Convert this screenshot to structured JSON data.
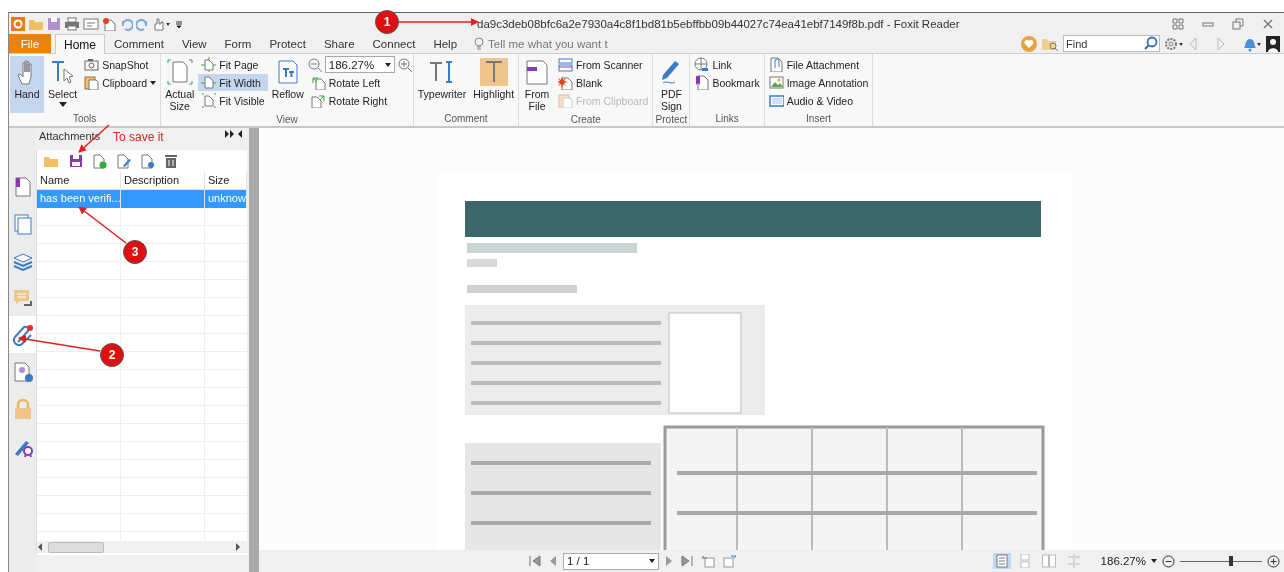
{
  "title_bar": {
    "title": "da9c3deb08bfc6a2e7930a4c8f1bd81b5ebffbb09b44027c74ea41ebf7149f8b.pdf - Foxit Reader"
  },
  "tabs": [
    {
      "label": "File",
      "kind": "file",
      "selected": false
    },
    {
      "label": "Home",
      "kind": "tab",
      "selected": true
    },
    {
      "label": "Comment",
      "kind": "tab",
      "selected": false
    },
    {
      "label": "View",
      "kind": "tab",
      "selected": false
    },
    {
      "label": "Form",
      "kind": "tab",
      "selected": false
    },
    {
      "label": "Protect",
      "kind": "tab",
      "selected": false
    },
    {
      "label": "Share",
      "kind": "tab",
      "selected": false
    },
    {
      "label": "Connect",
      "kind": "tab",
      "selected": false
    },
    {
      "label": "Help",
      "kind": "tab",
      "selected": false
    }
  ],
  "tell_me": {
    "placeholder": "Tell me what you want t"
  },
  "find": {
    "placeholder": "Find"
  },
  "ribbon": [
    {
      "label": "Tools",
      "columns": [
        {
          "kind": "large",
          "label": "Hand",
          "selected": true,
          "disabled": false
        },
        {
          "kind": "large-menu",
          "label": "Select",
          "selected": false,
          "disabled": false
        },
        {
          "kind": "stack",
          "items": [
            {
              "kind": "button",
              "label": "SnapShot",
              "selected": false,
              "disabled": false
            },
            {
              "kind": "menu",
              "label": "Clipboard",
              "selected": false,
              "disabled": false
            }
          ]
        }
      ]
    },
    {
      "label": "View",
      "columns": [
        {
          "kind": "large",
          "label": "Actual Size",
          "selected": false,
          "disabled": false
        },
        {
          "kind": "stack",
          "items": [
            {
              "kind": "button",
              "label": "Fit Page",
              "selected": false,
              "disabled": false
            },
            {
              "kind": "button",
              "label": "Fit Width",
              "selected": true,
              "disabled": false
            },
            {
              "kind": "button",
              "label": "Fit Visible",
              "selected": false,
              "disabled": false
            }
          ]
        },
        {
          "kind": "large",
          "label": "Reflow",
          "selected": false,
          "disabled": false
        },
        {
          "kind": "stack",
          "items": [
            {
              "kind": "zoom",
              "value": "186.27%"
            },
            {
              "kind": "button",
              "label": "Rotate Left",
              "selected": false,
              "disabled": false
            },
            {
              "kind": "button",
              "label": "Rotate Right",
              "selected": false,
              "disabled": false
            }
          ]
        }
      ]
    },
    {
      "label": "Comment",
      "columns": [
        {
          "kind": "large",
          "label": "Typewriter",
          "selected": false,
          "disabled": false
        },
        {
          "kind": "large",
          "label": "Highlight",
          "selected": false,
          "disabled": false
        }
      ]
    },
    {
      "label": "Create",
      "columns": [
        {
          "kind": "large",
          "label": "From File",
          "selected": false,
          "disabled": false
        },
        {
          "kind": "stack",
          "items": [
            {
              "kind": "button",
              "label": "From Scanner",
              "selected": false,
              "disabled": false
            },
            {
              "kind": "button",
              "label": "Blank",
              "selected": false,
              "disabled": false
            },
            {
              "kind": "button",
              "label": "From Clipboard",
              "selected": false,
              "disabled": true
            }
          ]
        }
      ]
    },
    {
      "label": "Protect",
      "columns": [
        {
          "kind": "large",
          "label": "PDF Sign",
          "selected": false,
          "disabled": false
        }
      ]
    },
    {
      "label": "Links",
      "columns": [
        {
          "kind": "stack",
          "items": [
            {
              "kind": "button",
              "label": "Link",
              "selected": false,
              "disabled": false
            },
            {
              "kind": "button",
              "label": "Bookmark",
              "selected": false,
              "disabled": false
            }
          ]
        }
      ]
    },
    {
      "label": "Insert",
      "columns": [
        {
          "kind": "stack",
          "items": [
            {
              "kind": "button",
              "label": "File Attachment",
              "selected": false,
              "disabled": false
            },
            {
              "kind": "button",
              "label": "Image Annotation",
              "selected": false,
              "disabled": false
            },
            {
              "kind": "button",
              "label": "Audio & Video",
              "selected": false,
              "disabled": false
            }
          ]
        }
      ]
    }
  ],
  "side_tabs": [
    {
      "selected": false
    },
    {
      "selected": false
    },
    {
      "selected": false
    },
    {
      "selected": false
    },
    {
      "selected": true
    },
    {
      "selected": false
    },
    {
      "selected": false
    },
    {
      "selected": false
    }
  ],
  "attachments": {
    "title": "Attachments",
    "columns": [
      "Name",
      "Description",
      "Size"
    ],
    "rows": [
      {
        "name": "has been verifi...",
        "size": "unknow",
        "selected": true
      }
    ]
  },
  "status_bar": {
    "page": "1 / 1",
    "zoom": "186.27%",
    "zoom_slider": {
      "level": 0.62
    }
  },
  "annotations": {
    "markers": [
      "1",
      "2",
      "3"
    ],
    "note": "To save it"
  }
}
